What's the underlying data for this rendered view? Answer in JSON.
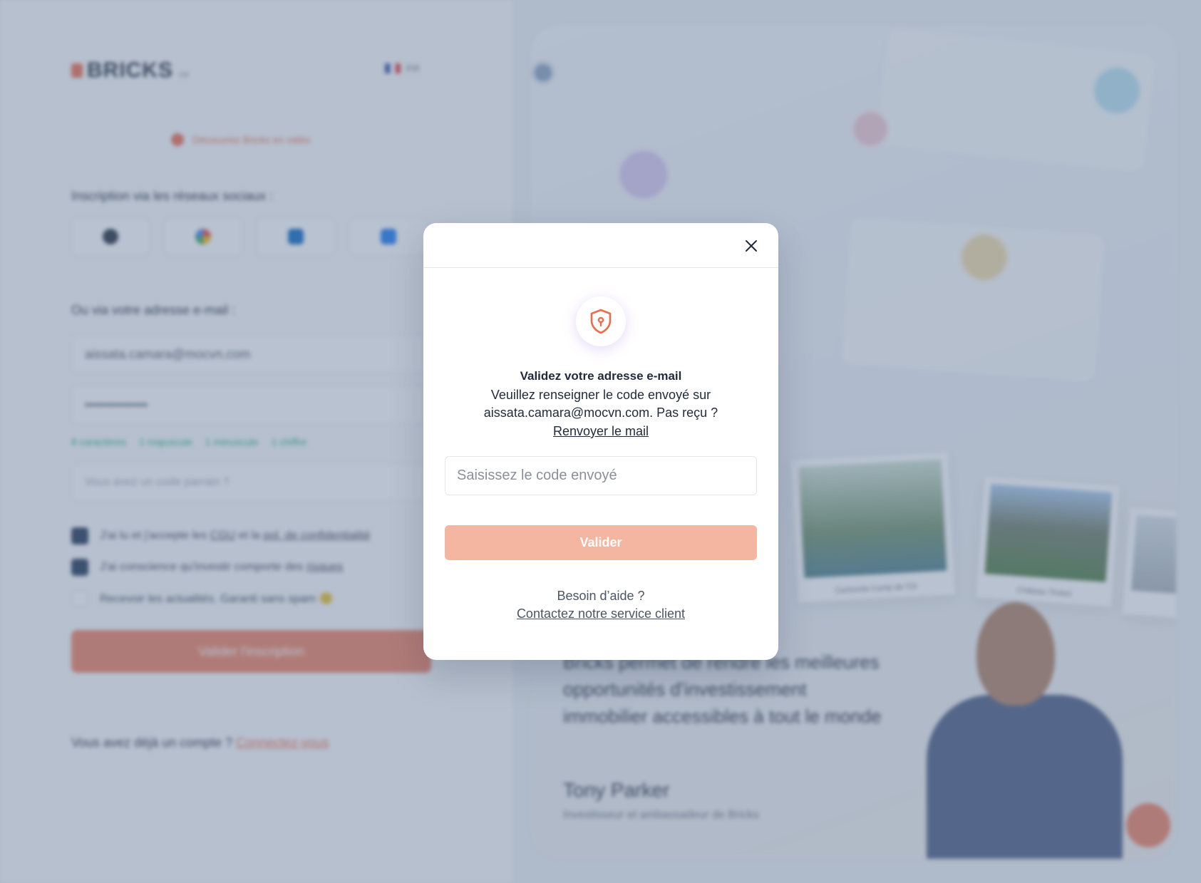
{
  "background": {
    "logo": {
      "brand": "BRICKS",
      "domain": ".co"
    },
    "language": "FR",
    "video_link": "Découvrez Bricks en vidéo",
    "social_label": "Inscription via les réseaux sociaux :",
    "email_label": "Ou via votre adresse e-mail :",
    "email_value": "aissata.camara@mocvn.com",
    "password_value": "••••••••••••••",
    "password_rules": [
      "8 caractères",
      "1 majuscule",
      "1 minuscule",
      "1 chiffre"
    ],
    "referral_placeholder": "Vous avez un code parrain ?",
    "checkbox_1_prefix": "J'ai lu et j'accepte les",
    "checkbox_1_link1": "CGU",
    "checkbox_1_mid": "et la",
    "checkbox_1_link2": "pol. de confidentialité",
    "checkbox_2_prefix": "J'ai conscience qu'investir comporte des",
    "checkbox_2_link": "risques",
    "checkbox_3": "Recevoir les actualités. Garanti sans spam 🙂",
    "submit_label": "Valider l'inscription",
    "have_account": "Vous avez déjà un compte ?",
    "login_link": "Connectez-vous",
    "quote": "Bricks permet de rendre les meilleures opportunités d'investissement immobilier accessibles à tout le monde",
    "person_name": "Tony Parker",
    "person_role": "Investisseur et ambassadeur de Bricks",
    "photo_captions": [
      "Carbonite Camp de l'Or",
      "Château Tiretez",
      ""
    ]
  },
  "modal": {
    "title": "Validez votre adresse e-mail",
    "description": "Veuillez renseigner le code envoyé sur aissata.camara@mocvn.com. Pas reçu ?",
    "resend_link": "Renvoyer le mail",
    "code_placeholder": "Saisissez le code envoyé",
    "code_value": "",
    "submit_label": "Valider",
    "help_text": "Besoin d’aide ?",
    "contact_link": "Contactez notre service client"
  },
  "colors": {
    "accent": "#ef6b4a",
    "button_disabled": "#f5b6a1",
    "text_dark": "#1f2a3a",
    "overlay": "rgba(98,120,150,0.45)"
  },
  "icons": {
    "close": "close-icon",
    "shield": "shield-lock-icon",
    "chat": "chat-icon"
  }
}
